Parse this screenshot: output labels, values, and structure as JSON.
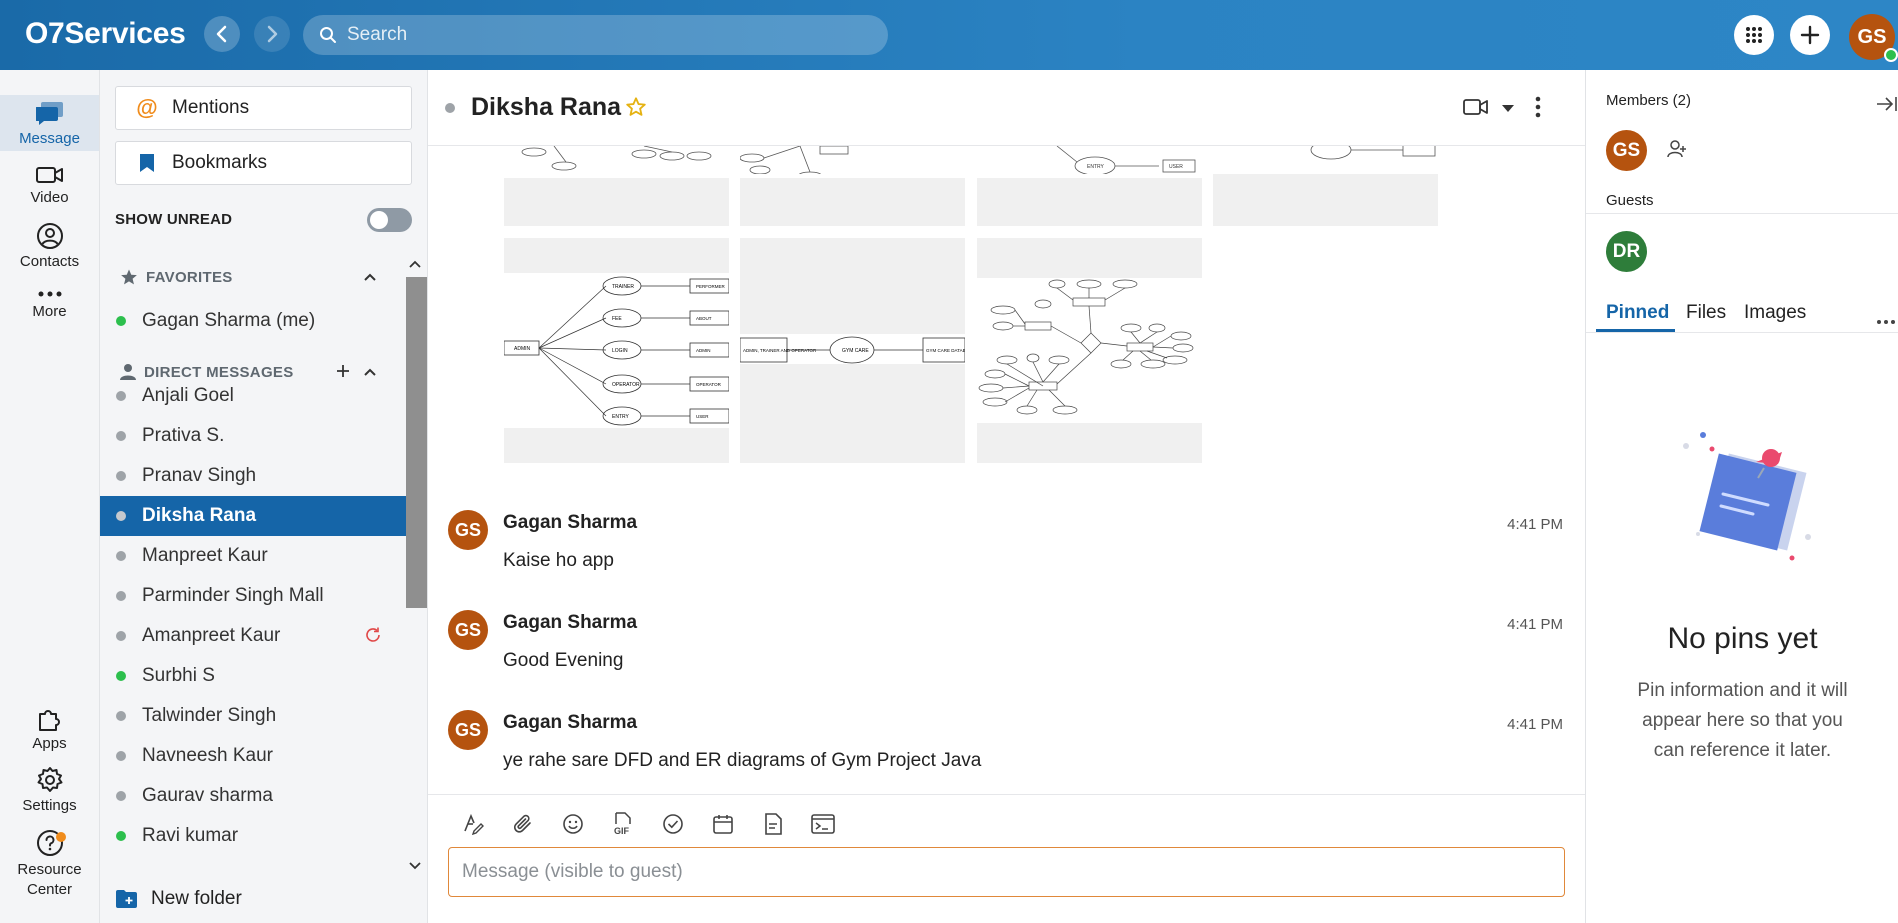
{
  "app": {
    "brand": "O7Services",
    "search_placeholder": "Search",
    "user_initials": "GS",
    "accent": "#1565a8",
    "topbar_color": "#2b83c3",
    "avatar_color": "#b5530f"
  },
  "rail": {
    "items": [
      {
        "label": "Message",
        "icon": "message-icon",
        "active": true
      },
      {
        "label": "Video",
        "icon": "video-icon"
      },
      {
        "label": "Contacts",
        "icon": "contacts-icon"
      },
      {
        "label": "More",
        "icon": "more-icon"
      },
      {
        "label": "Apps",
        "icon": "apps-icon"
      },
      {
        "label": "Settings",
        "icon": "settings-icon"
      },
      {
        "label": "Resource Center",
        "icon": "help-icon"
      }
    ]
  },
  "sidebar": {
    "mentions": "Mentions",
    "bookmarks": "Bookmarks",
    "show_unread": "SHOW UNREAD",
    "favorites_header": "FAVORITES",
    "favorites": [
      {
        "name": "Gagan Sharma (me)",
        "status": "online"
      }
    ],
    "dm_header": "DIRECT MESSAGES",
    "dms": [
      {
        "name": "Anjali Goel",
        "status": "offline"
      },
      {
        "name": "Prativa S.",
        "status": "offline"
      },
      {
        "name": "Pranav Singh",
        "status": "offline"
      },
      {
        "name": "Diksha Rana",
        "status": "offline",
        "active": true
      },
      {
        "name": "Manpreet Kaur",
        "status": "offline"
      },
      {
        "name": "Parminder Singh Mall",
        "status": "offline"
      },
      {
        "name": "Amanpreet Kaur",
        "status": "offline",
        "refresh": true
      },
      {
        "name": "Surbhi S",
        "status": "online"
      },
      {
        "name": "Talwinder Singh",
        "status": "offline"
      },
      {
        "name": "Navneesh Kaur",
        "status": "offline"
      },
      {
        "name": "Gaurav sharma",
        "status": "offline"
      },
      {
        "name": "Ravi kumar",
        "status": "online"
      }
    ],
    "new_folder": "New folder"
  },
  "chat": {
    "title": "Diksha Rana",
    "messages": [
      {
        "initials": "GS",
        "author": "Gagan Sharma",
        "time": "4:41 PM",
        "text": "Kaise ho app"
      },
      {
        "initials": "GS",
        "author": "Gagan Sharma",
        "time": "4:41 PM",
        "text": "Good Evening"
      },
      {
        "initials": "GS",
        "author": "Gagan Sharma",
        "time": "4:41 PM",
        "text": "ye rahe sare DFD and ER diagrams of Gym Project Java"
      }
    ],
    "diagram_labels": {
      "d1": {
        "center": "ADMIN",
        "nodes": [
          "TRAINER",
          "FEE",
          "LOGIN",
          "OPERATOR",
          "ENTRY"
        ],
        "right": [
          "PERFORMER",
          "ABOUT",
          "ADMIN",
          "OPERATOR",
          "USER"
        ]
      },
      "d2": {
        "left": "ADMIN, TRAINER AND OPERATOR",
        "center": "GYM CARE",
        "right": "GYM CARE DATABASE"
      }
    },
    "composer_placeholder": "Message (visible to guest)"
  },
  "panel": {
    "members_header": "Members (2)",
    "member_initials": "GS",
    "guests_header": "Guests",
    "guest_initials": "DR",
    "guest_color": "#2e7d3a",
    "tabs": [
      "Pinned",
      "Files",
      "Images"
    ],
    "empty_title": "No pins yet",
    "empty_text": "Pin information and it will appear here so that you can reference it later."
  }
}
